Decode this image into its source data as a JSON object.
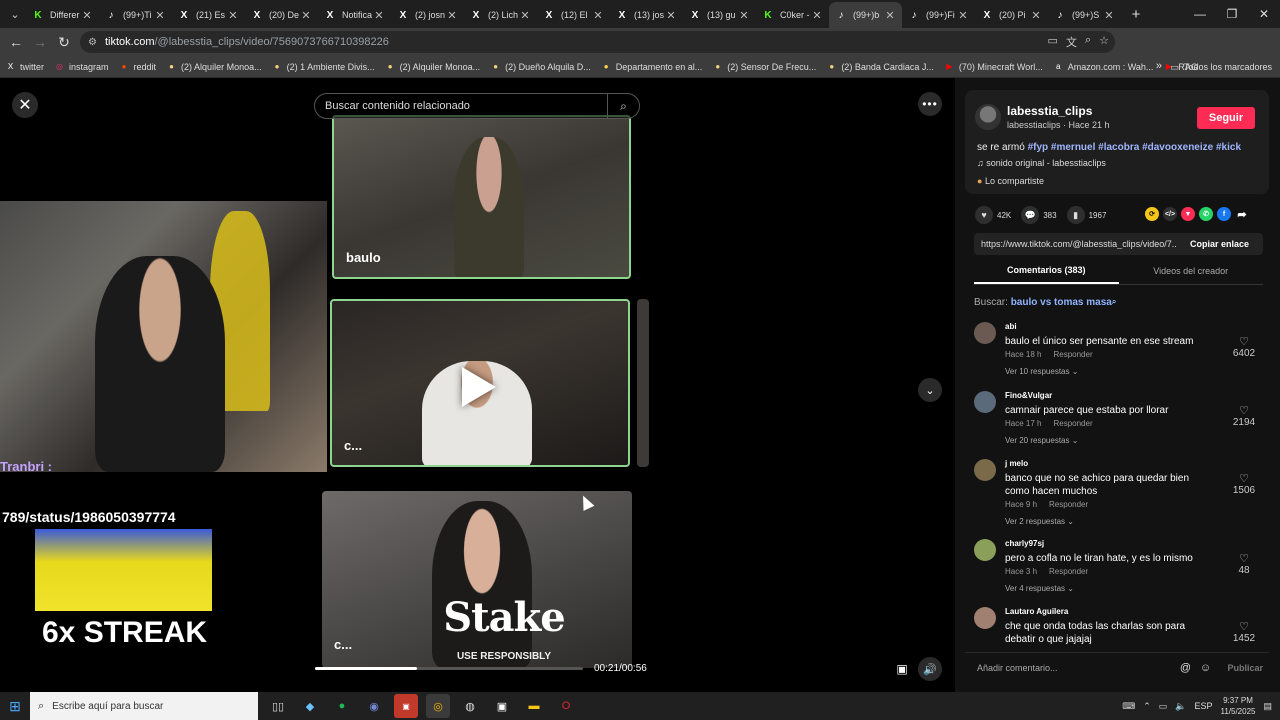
{
  "tabs": [
    {
      "title": "Differer",
      "icon": "K",
      "color": "#53fc18",
      "active": false
    },
    {
      "title": "(99+)Ti",
      "icon": "♪",
      "color": "#ffffff",
      "active": false
    },
    {
      "title": "(21) Es",
      "icon": "X",
      "color": "#ffffff",
      "active": false
    },
    {
      "title": "(20) De",
      "icon": "X",
      "color": "#ffffff",
      "active": false
    },
    {
      "title": "Notifica",
      "icon": "X",
      "color": "#ffffff",
      "active": false
    },
    {
      "title": "(2) josn",
      "icon": "X",
      "color": "#ffffff",
      "active": false
    },
    {
      "title": "(2) Lich",
      "icon": "X",
      "color": "#ffffff",
      "active": false
    },
    {
      "title": "(12) El",
      "icon": "X",
      "color": "#ffffff",
      "active": false
    },
    {
      "title": "(13) jos",
      "icon": "X",
      "color": "#ffffff",
      "active": false
    },
    {
      "title": "(13) gu",
      "icon": "X",
      "color": "#ffffff",
      "active": false
    },
    {
      "title": "C0ker -",
      "icon": "K",
      "color": "#53fc18",
      "active": false
    },
    {
      "title": "(99+)b",
      "icon": "♪",
      "color": "#ffffff",
      "active": true
    },
    {
      "title": "(99+)Fi",
      "icon": "♪",
      "color": "#ffffff",
      "active": false
    },
    {
      "title": "(20) Pi",
      "icon": "X",
      "color": "#ffffff",
      "active": false
    },
    {
      "title": "(99+)S",
      "icon": "♪",
      "color": "#ffffff",
      "active": false
    }
  ],
  "address": {
    "domain": "tiktok.com",
    "path": "/@labesstia_clips/video/7569073766710398226"
  },
  "bookmarks": [
    {
      "label": "twitter",
      "icon": "X",
      "color": "#ffffff"
    },
    {
      "label": "instagram",
      "icon": "◎",
      "color": "#e1306c"
    },
    {
      "label": "reddit",
      "icon": "●",
      "color": "#ff4500"
    },
    {
      "label": "(2) Alquiler Monoa...",
      "icon": "●",
      "color": "#f4d37a"
    },
    {
      "label": "(2) 1 Ambiente Divis...",
      "icon": "●",
      "color": "#f4d37a"
    },
    {
      "label": "(2) Alquiler Monoa...",
      "icon": "●",
      "color": "#f4d37a"
    },
    {
      "label": "(2) Dueño Alquila D...",
      "icon": "●",
      "color": "#f4d37a"
    },
    {
      "label": "Departamento en al...",
      "icon": "●",
      "color": "#ffd54a"
    },
    {
      "label": "(2) Sensor De Frecu...",
      "icon": "●",
      "color": "#f4d37a"
    },
    {
      "label": "(2) Banda Cardiaca J...",
      "icon": "●",
      "color": "#f4d37a"
    },
    {
      "label": "(70) Minecraft Worl...",
      "icon": "▶",
      "color": "#ff0000"
    },
    {
      "label": "Amazon.com : Wah...",
      "icon": "a",
      "color": "#ffffff"
    },
    {
      "label": "RAG",
      "icon": "▶",
      "color": "#ff0000"
    }
  ],
  "bookmarks_all": "Todos los marcadores",
  "player": {
    "search_placeholder": "Buscar contenido relacionado",
    "chat_name": "Tranbri :",
    "status_text": "789/status/1986050397774",
    "streak_text": "6x STREAK",
    "card1_label": "baulo",
    "card2_label": "c...",
    "card3_label": "c...",
    "stake_logo": "Stake",
    "stake_sub": "USE RESPONSIBLY",
    "time": "00:21/00:56",
    "progress": 0.38
  },
  "author": {
    "name": "labesstia_clips",
    "sub": "labesstiaclips · Hace 21 h",
    "follow": "Seguir",
    "caption_prefix": "se re armó",
    "hashtags": "#fyp #mernuel #lacobra #davooxeneize #kick",
    "sound": "sonido original - labesstiaclips",
    "shared": "Lo compartiste"
  },
  "stats": {
    "likes": "42K",
    "comments": "383",
    "saves": "1967"
  },
  "link": {
    "url": "https://www.tiktok.com/@labesstia_clips/video/7...",
    "copy": "Copiar enlace"
  },
  "panel_tabs": {
    "comments": "Comentarios (383)",
    "creator": "Videos del creador"
  },
  "search_suggestion": {
    "prefix": "Buscar:",
    "query": "baulo vs tomas masa"
  },
  "comments": [
    {
      "user": "abi",
      "text": "baulo el único ser pensante en ese stream",
      "time": "Hace 18 h",
      "reply": "Responder",
      "replies": "Ver 10 respuestas",
      "likes": "6402",
      "avatar": "#6b5a52"
    },
    {
      "user": "Fino&Vulgar",
      "text": "camnair parece que estaba por llorar",
      "time": "Hace 17 h",
      "reply": "Responder",
      "replies": "Ver 20 respuestas",
      "likes": "2194",
      "avatar": "#5b6a7a"
    },
    {
      "user": "j melo",
      "text": "banco que no se achico para quedar bien como hacen muchos",
      "time": "Hace 9 h",
      "reply": "Responder",
      "replies": "Ver 2 respuestas",
      "likes": "1506",
      "avatar": "#7a6a4a"
    },
    {
      "user": "charly97sj",
      "text": "pero a cofla no le tiran hate, y es lo mismo",
      "time": "Hace 3 h",
      "reply": "Responder",
      "replies": "Ver 4 respuestas",
      "likes": "48",
      "avatar": "#8aa05a"
    },
    {
      "user": "Lautaro Aguilera",
      "text": "che que onda todas las charlas son para debatir o que jajajaj",
      "time": "",
      "reply": "",
      "replies": "",
      "likes": "1452",
      "avatar": "#a08070"
    }
  ],
  "comment_input": {
    "placeholder": "Añadir comentario...",
    "publish": "Publicar"
  },
  "taskbar": {
    "search_placeholder": "Escribe aquí para buscar",
    "lang": "ESP",
    "time": "9:37 PM",
    "date": "11/5/2025"
  }
}
